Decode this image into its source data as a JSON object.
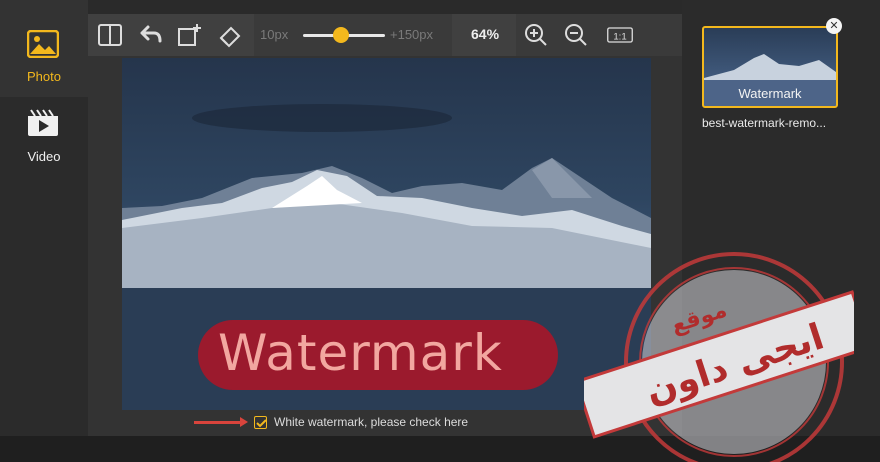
{
  "app": {
    "accent": "#f3b81d"
  },
  "sidebar": {
    "items": [
      {
        "label": "Photo",
        "icon": "image-icon",
        "active": true
      },
      {
        "label": "Video",
        "icon": "video-icon",
        "active": false
      }
    ]
  },
  "toolbar": {
    "brush_min": "10px",
    "brush_max": "+150px",
    "brush_size_fraction": 0.45,
    "zoom": "64%",
    "actual_size": "1:1"
  },
  "canvas": {
    "watermark_text": "Watermark",
    "checkbox_label": "White watermark, please check here",
    "checkbox_checked": true
  },
  "files": [
    {
      "caption": "Watermark",
      "name": "best-watermark-remo..."
    }
  ],
  "stamp": {
    "line1": "موقع",
    "line2": "ايجى داون"
  }
}
